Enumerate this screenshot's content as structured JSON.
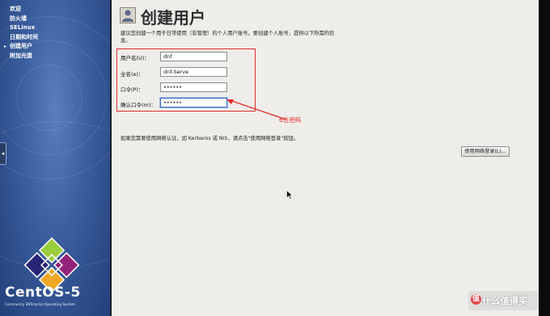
{
  "sidebar": {
    "steps": [
      {
        "label": "欢迎",
        "current": false
      },
      {
        "label": "防火墙",
        "current": false
      },
      {
        "label": "SELinux",
        "current": false
      },
      {
        "label": "日期和时间",
        "current": false
      },
      {
        "label": "创建用户",
        "current": true
      },
      {
        "label": "附加光盘",
        "current": false
      }
    ],
    "current_marker": "▸",
    "handle_glyph": "◂",
    "brand_name": "CentOS-5",
    "brand_subtitle": "Community ENTerprise Operating System",
    "logo_colors": [
      "#9ccd3c",
      "#932279",
      "#efa724",
      "#262577"
    ]
  },
  "main": {
    "title": "创建用户",
    "intro": "建议您创建一个用于日常使用（非管理）的个人用户账号。要创建个人账号，提供以下所需的信息。",
    "fields": [
      {
        "label": "用户名(U)：",
        "value": "dnf",
        "focused": false
      },
      {
        "label": "全名(e)：",
        "value": "dnf-Serve",
        "focused": false
      },
      {
        "label": "口令(P)：",
        "value": "••••••",
        "focused": false
      },
      {
        "label": "确认口令(m)：",
        "value": "••••••",
        "focused": true
      }
    ],
    "annotation": "6位密码",
    "annotation_color": "#e02a2a",
    "network_text": "如果您需要使用网络认证，如 Kerberos 或 NIS，请点击\"使用网络登录\"按钮。",
    "network_button": "使用网络登录(L)..."
  },
  "watermark": {
    "text": "什么值得买",
    "icon": "值"
  }
}
